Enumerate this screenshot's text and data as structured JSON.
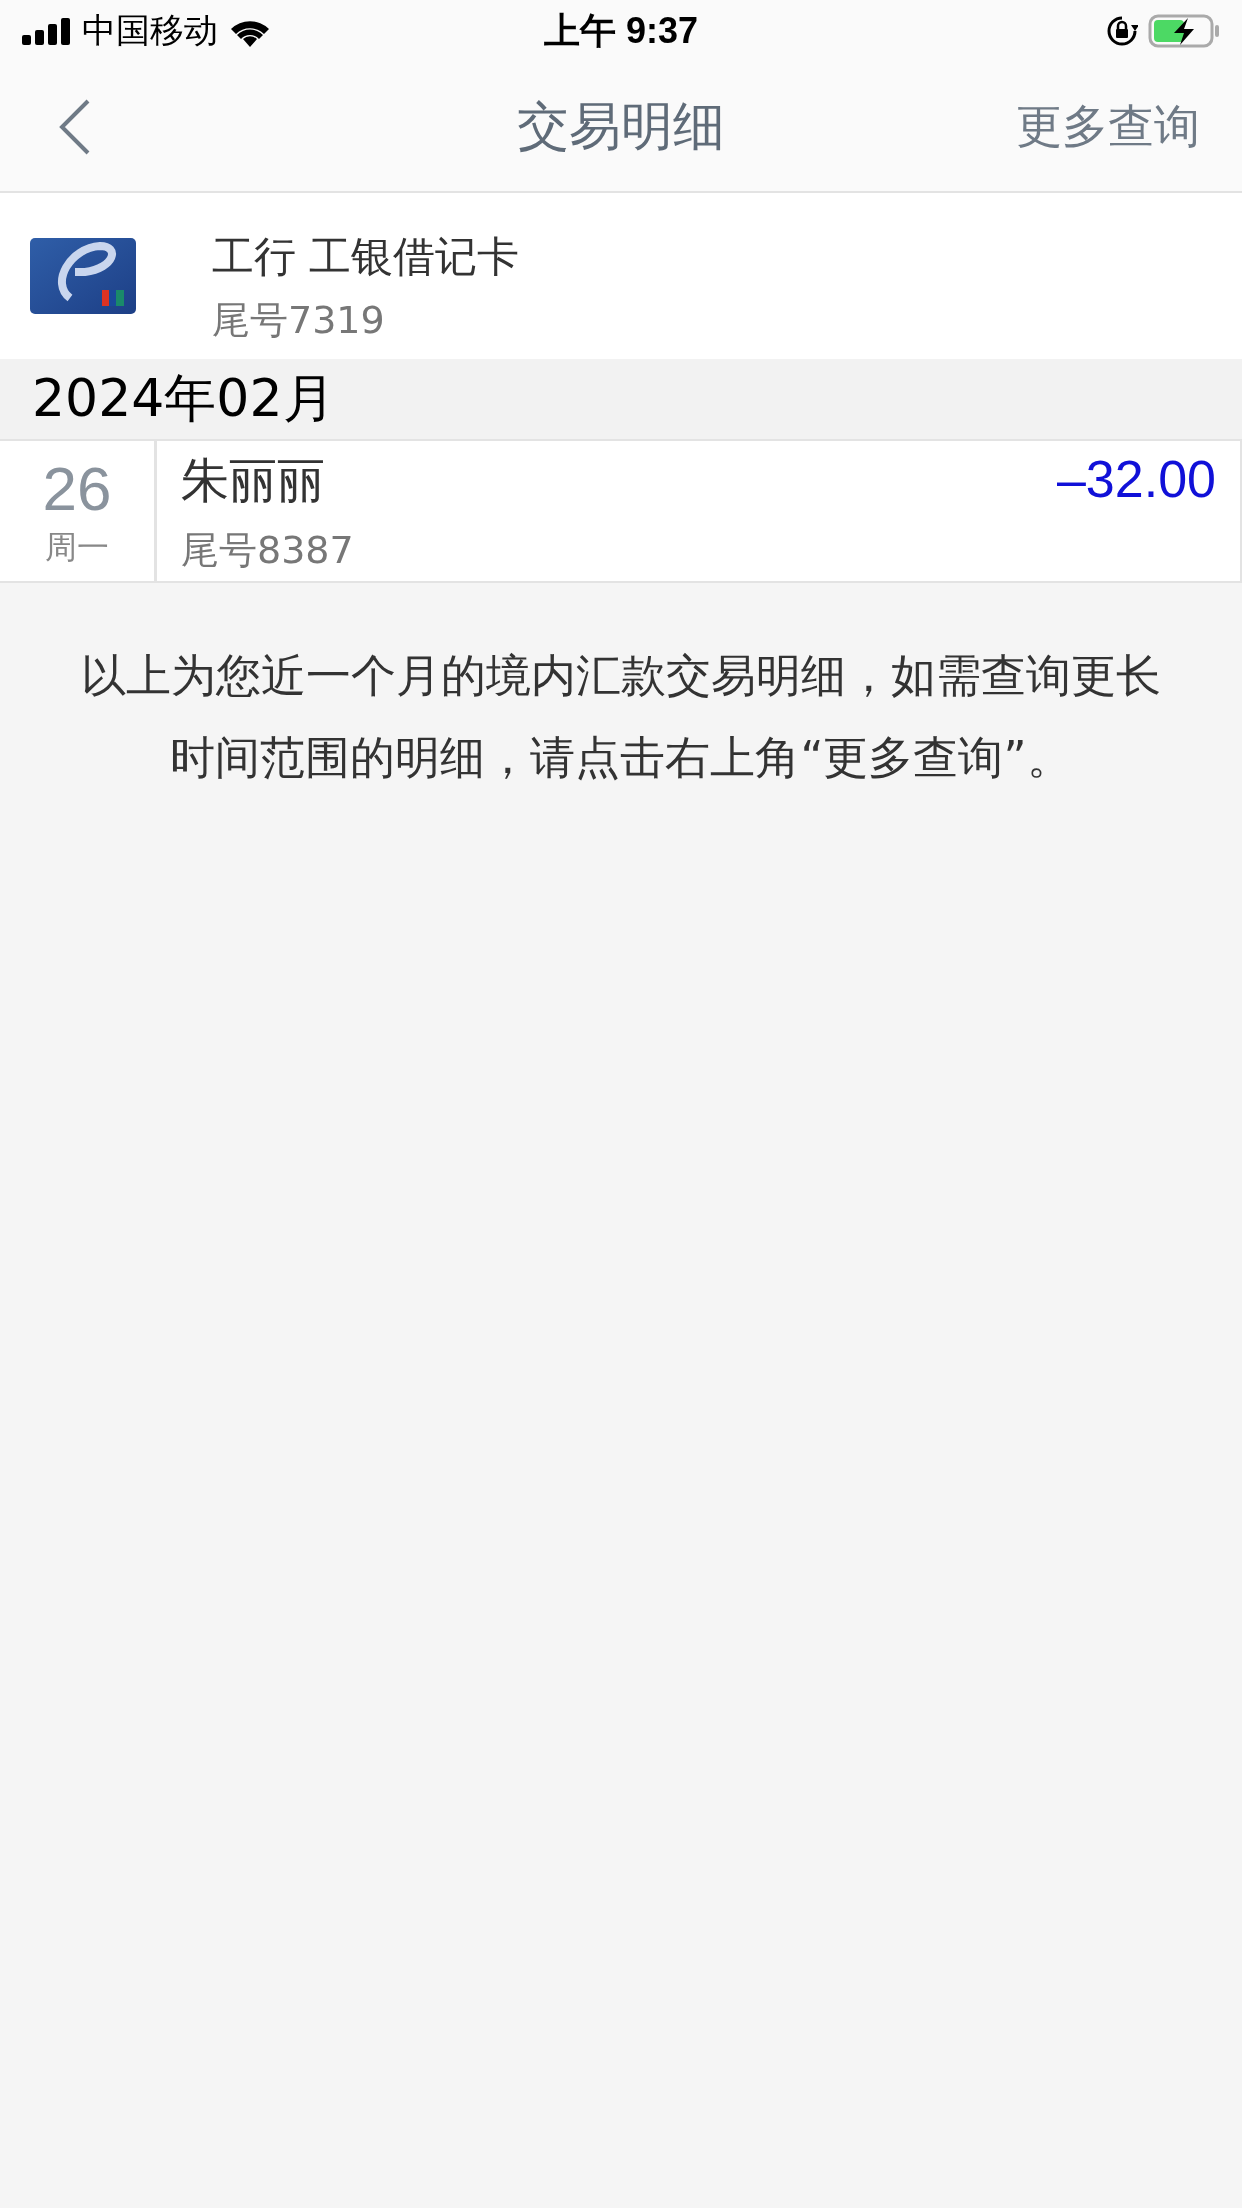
{
  "status_bar": {
    "carrier": "中国移动",
    "time": "上午 9:37"
  },
  "nav": {
    "title": "交易明细",
    "action": "更多查询"
  },
  "account": {
    "name": "工行 工银借记卡",
    "tail": "尾号7319"
  },
  "months": [
    {
      "label": "2024年02月",
      "transactions": [
        {
          "day": "26",
          "weekday": "周一",
          "payee": "朱丽丽",
          "tail": "尾号8387",
          "amount": "–32.00",
          "color": "#1010d8"
        }
      ]
    }
  ],
  "note": "以上为您近一个月的境内汇款交易明细，如需查询更长时间范围的明细，请点击右上角“更多查询”。"
}
